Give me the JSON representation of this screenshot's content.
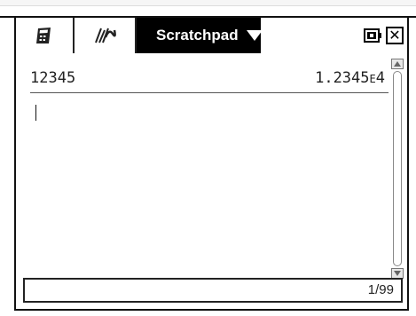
{
  "app": {
    "tabs": [
      {
        "name": "calculator",
        "icon": "calculator-icon"
      },
      {
        "name": "graphs",
        "icon": "graph-icon"
      }
    ],
    "active_tab_label": "Scratchpad",
    "status_icons": [
      "battery-icon",
      "close-icon"
    ]
  },
  "history": {
    "entries": [
      {
        "input": "12345",
        "result_mantissa": "1.2345",
        "result_exp_marker": "E",
        "result_exponent": "4"
      }
    ]
  },
  "statusbar": {
    "page_indicator": "1/99"
  }
}
